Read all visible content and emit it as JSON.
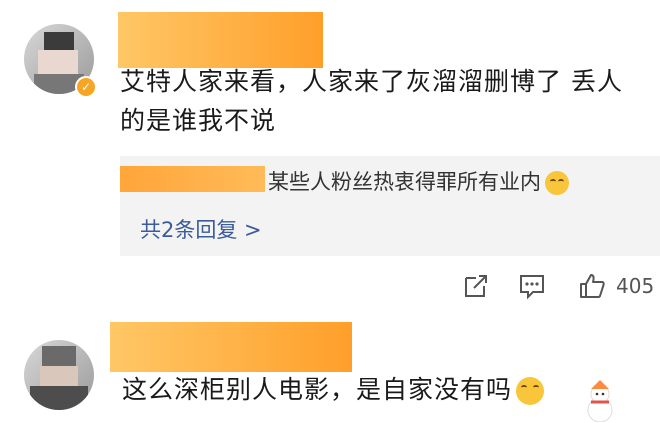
{
  "comments": [
    {
      "text_line1": "艾特人家来看，人家来了灰溜溜删博了 丢人",
      "text_line2": "的是谁我不说",
      "reply": {
        "text": "某些人粉丝热衷得罪所有业内",
        "emoji": "smirk-emoji",
        "more_label": "共2条回复 >"
      },
      "actions": {
        "share_icon": "share-icon",
        "comment_icon": "comment-icon",
        "like_icon": "thumbs-up-icon",
        "like_count": "405"
      }
    },
    {
      "text": "这么深柜别人电影，是自家没有吗",
      "emoji": "shush-emoji",
      "sticker": "snowman-sticker"
    }
  ],
  "colors": {
    "username_mask": "#ffb14a",
    "reply_bg": "#f3f3f4",
    "link": "#3a5c9a",
    "badge": "#f6a623"
  }
}
